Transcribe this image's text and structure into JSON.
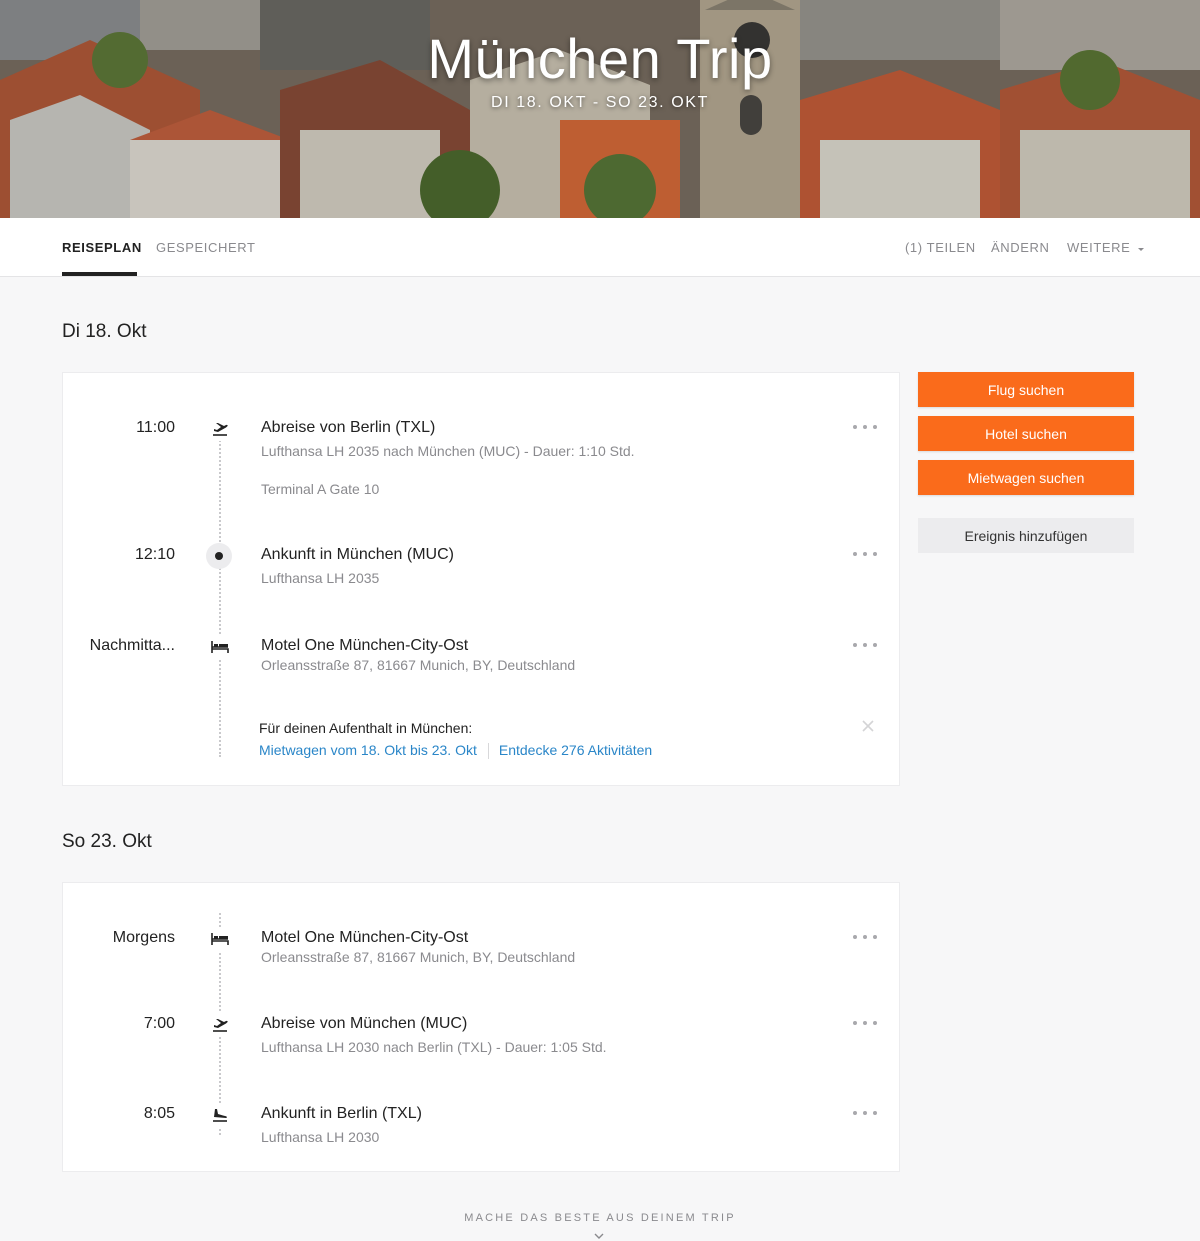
{
  "hero": {
    "title": "München Trip",
    "dates": "DI 18. OKT - SO 23. OKT"
  },
  "tabs": [
    {
      "label": "REISEPLAN",
      "active": true
    },
    {
      "label": "GESPEICHERT",
      "active": false
    }
  ],
  "actions": {
    "share": "(1) TEILEN",
    "edit": "ÄNDERN",
    "more": "WEITERE",
    "more_icon": "caret-down-icon"
  },
  "days": [
    {
      "heading": "Di 18. Okt",
      "events": [
        {
          "time": "11:00",
          "icon": "plane-takeoff-icon",
          "title": "Abreise von Berlin (TXL)",
          "sub": "Lufthansa LH 2035 nach München (MUC) - Dauer: 1:10 Std.",
          "sub2": "Terminal A Gate 10"
        },
        {
          "time": "12:10",
          "icon": "arrival-dot-icon",
          "title": "Ankunft in München (MUC)",
          "sub": "Lufthansa LH 2035"
        },
        {
          "time": "Nachmitta...",
          "icon": "bed-icon",
          "title": "Motel One München-City-Ost",
          "sub": "Orleansstraße 87, 81667 Munich, BY, Deutschland"
        }
      ],
      "stay": {
        "label": "Für deinen Aufenthalt in München:",
        "link1": "Mietwagen vom 18. Okt bis 23. Okt",
        "link2": "Entdecke 276 Aktivitäten"
      }
    },
    {
      "heading": "So 23. Okt",
      "events": [
        {
          "time": "Morgens",
          "icon": "bed-icon",
          "title": "Motel One München-City-Ost",
          "sub": "Orleansstraße 87, 81667 Munich, BY, Deutschland"
        },
        {
          "time": "7:00",
          "icon": "plane-takeoff-icon",
          "title": "Abreise von München (MUC)",
          "sub": "Lufthansa LH 2030 nach Berlin (TXL) - Dauer: 1:05 Std."
        },
        {
          "time": "8:05",
          "icon": "plane-landing-icon",
          "title": "Ankunft in Berlin (TXL)",
          "sub": "Lufthansa LH 2030"
        }
      ]
    }
  ],
  "sidebar": {
    "flight": "Flug suchen",
    "hotel": "Hotel suchen",
    "car": "Mietwagen suchen",
    "add_event": "Ereignis hinzufügen"
  },
  "footer": {
    "cta": "MACHE DAS BESTE AUS DEINEM TRIP",
    "icon": "chevron-down-icon"
  },
  "colors": {
    "accent": "#fa6b1b",
    "link": "#2a86c8",
    "text": "#222222",
    "muted": "#8a8a8e"
  }
}
